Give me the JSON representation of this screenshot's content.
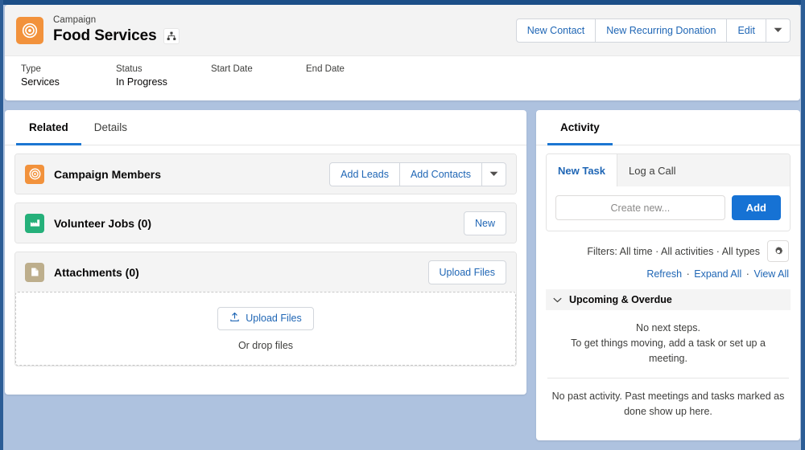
{
  "window": {
    "chrome_color": "#1b4e87",
    "backdrop_color": "#aec2df"
  },
  "header": {
    "icon": "campaign-target-icon",
    "icon_color": "#f2923c",
    "eyebrow": "Campaign",
    "title": "Food Services",
    "hierarchy_icon": "hierarchy-icon",
    "actions": [
      {
        "label": "New Contact",
        "name": "new-contact-button"
      },
      {
        "label": "New Recurring Donation",
        "name": "new-recurring-donation-button"
      },
      {
        "label": "Edit",
        "name": "edit-button"
      }
    ],
    "caret_icon": "chevron-down-icon",
    "fields": [
      {
        "label": "Type",
        "value": "Services"
      },
      {
        "label": "Status",
        "value": "In Progress"
      },
      {
        "label": "Start Date",
        "value": ""
      },
      {
        "label": "End Date",
        "value": ""
      }
    ]
  },
  "left_panel": {
    "tabs": [
      {
        "label": "Related",
        "active": true
      },
      {
        "label": "Details",
        "active": false
      }
    ],
    "cards": [
      {
        "title": "Campaign Members",
        "icon": "campaign-target-icon",
        "icon_color": "#f2923c",
        "buttons": [
          {
            "label": "Add Leads",
            "name": "add-leads-button"
          },
          {
            "label": "Add Contacts",
            "name": "add-contacts-button"
          }
        ],
        "has_caret": true
      },
      {
        "title": "Volunteer Jobs (0)",
        "icon": "volunteer-jobs-icon",
        "icon_color": "#25b07a",
        "buttons": [
          {
            "label": "New",
            "name": "new-volunteer-job-button"
          }
        ],
        "has_caret": false
      },
      {
        "title": "Attachments (0)",
        "icon": "attachment-document-icon",
        "icon_color": "#bdae8c",
        "buttons": [
          {
            "label": "Upload Files",
            "name": "upload-files-header-button"
          }
        ],
        "has_caret": false
      }
    ],
    "dropzone": {
      "button_label": "Upload Files",
      "button_icon": "upload-icon",
      "hint": "Or drop files"
    }
  },
  "activity_panel": {
    "tabs": [
      {
        "label": "Activity",
        "active": true
      }
    ],
    "composer": {
      "tabs": [
        {
          "label": "New Task",
          "active": true
        },
        {
          "label": "Log a Call",
          "active": false
        }
      ],
      "input_placeholder": "Create new...",
      "input_value": "",
      "add_label": "Add"
    },
    "filters": {
      "text": "Filters: All time · All activities · All types",
      "gear_icon": "gear-icon"
    },
    "links": [
      {
        "label": "Refresh",
        "name": "refresh-link"
      },
      {
        "label": "Expand All",
        "name": "expand-all-link"
      },
      {
        "label": "View All",
        "name": "view-all-link"
      }
    ],
    "link_separator": "·",
    "section": {
      "title": "Upcoming & Overdue",
      "toggle_icon": "chevron-down-icon",
      "empty_line1": "No next steps.",
      "empty_line2": "To get things moving, add a task or set up a meeting."
    },
    "past_activity": "No past activity. Past meetings and tasks marked as done show up here."
  },
  "colors": {
    "accent_blue": "#1f66b5",
    "primary_button": "#1672d4",
    "tab_underline": "#1b76d2"
  }
}
